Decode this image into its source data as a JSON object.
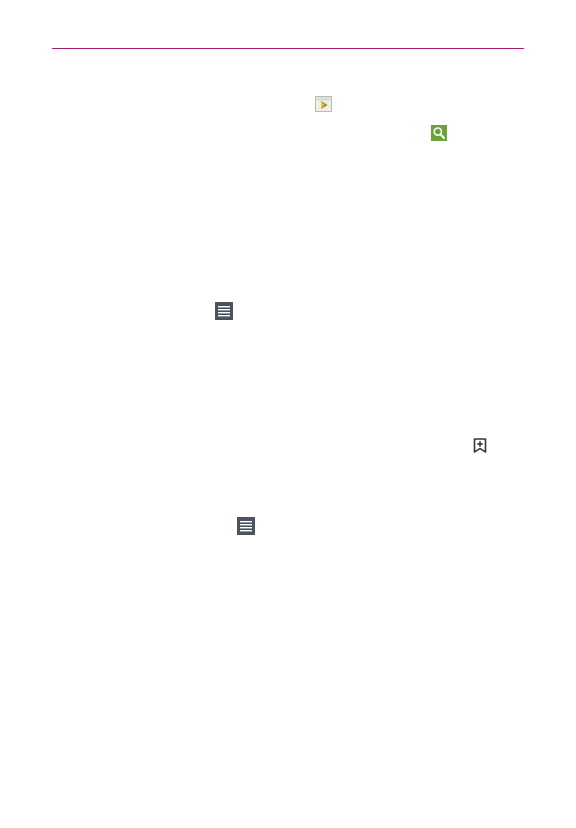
{
  "colors": {
    "header_rule": "#a4206f",
    "menu_icon": "#4b5260",
    "search_icon": "#6aa33c",
    "bookmark_icon": "#333333"
  },
  "icons": [
    {
      "name": "play-store-icon"
    },
    {
      "name": "search-icon"
    },
    {
      "name": "menu-icon"
    },
    {
      "name": "bookmark-add-icon"
    },
    {
      "name": "menu-icon"
    }
  ]
}
